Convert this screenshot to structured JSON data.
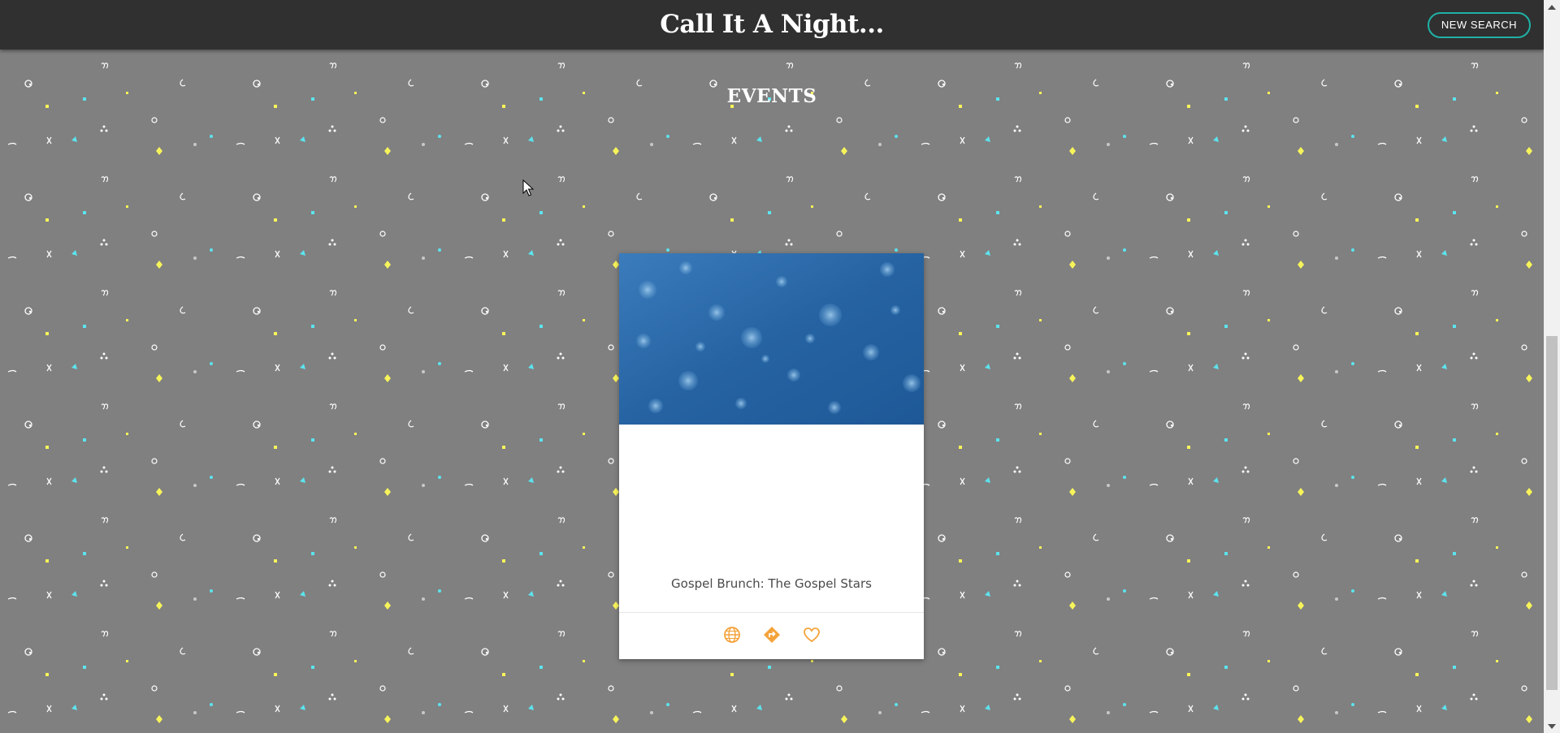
{
  "header": {
    "title": "Call It A Night...",
    "new_search_label": "NEW SEARCH"
  },
  "events_section": {
    "heading": "EVENTS",
    "cards": [
      {
        "title": "Gospel Brunch: The Gospel Stars",
        "actions": [
          "globe-icon",
          "directions-icon",
          "heart-icon"
        ]
      }
    ]
  },
  "colors": {
    "header_bg": "#303030",
    "page_bg": "#808080",
    "accent_teal": "#1fb2a6",
    "action_orange": "#f4a33a",
    "card_image_blue": "#2a6aa8"
  }
}
